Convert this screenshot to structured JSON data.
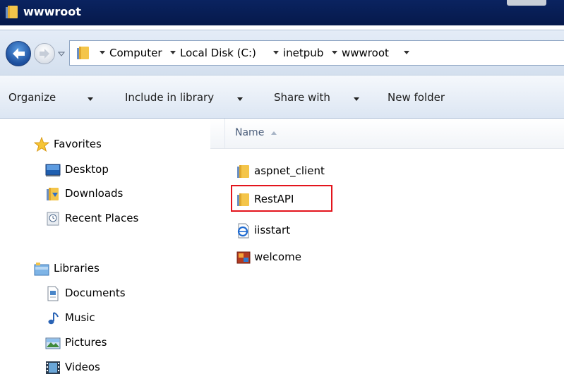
{
  "window": {
    "title": "wwwroot"
  },
  "address": {
    "crumbs": [
      "Computer",
      "Local Disk (C:)",
      "inetpub",
      "wwwroot"
    ]
  },
  "toolbar": {
    "organize": "Organize",
    "include_in_library": "Include in library",
    "share_with": "Share with",
    "new_folder": "New folder"
  },
  "nav": {
    "favorites": {
      "label": "Favorites",
      "items": [
        {
          "label": "Desktop",
          "icon": "desktop-icon"
        },
        {
          "label": "Downloads",
          "icon": "downloads-folder-icon"
        },
        {
          "label": "Recent Places",
          "icon": "recent-places-icon"
        }
      ]
    },
    "libraries": {
      "label": "Libraries",
      "items": [
        {
          "label": "Documents",
          "icon": "documents-icon"
        },
        {
          "label": "Music",
          "icon": "music-icon"
        },
        {
          "label": "Pictures",
          "icon": "pictures-icon"
        },
        {
          "label": "Videos",
          "icon": "videos-icon"
        }
      ]
    }
  },
  "content": {
    "column_name": "Name",
    "files": [
      {
        "name": "aspnet_client",
        "icon": "folder-icon"
      },
      {
        "name": "RestAPI",
        "icon": "folder-icon",
        "highlighted": true
      },
      {
        "name": "iisstart",
        "icon": "html-file-icon"
      },
      {
        "name": "welcome",
        "icon": "image-file-icon"
      }
    ]
  },
  "colors": {
    "title_bar": "#0a2360",
    "highlight": "#e3141c",
    "folder": "#f2c14e"
  }
}
